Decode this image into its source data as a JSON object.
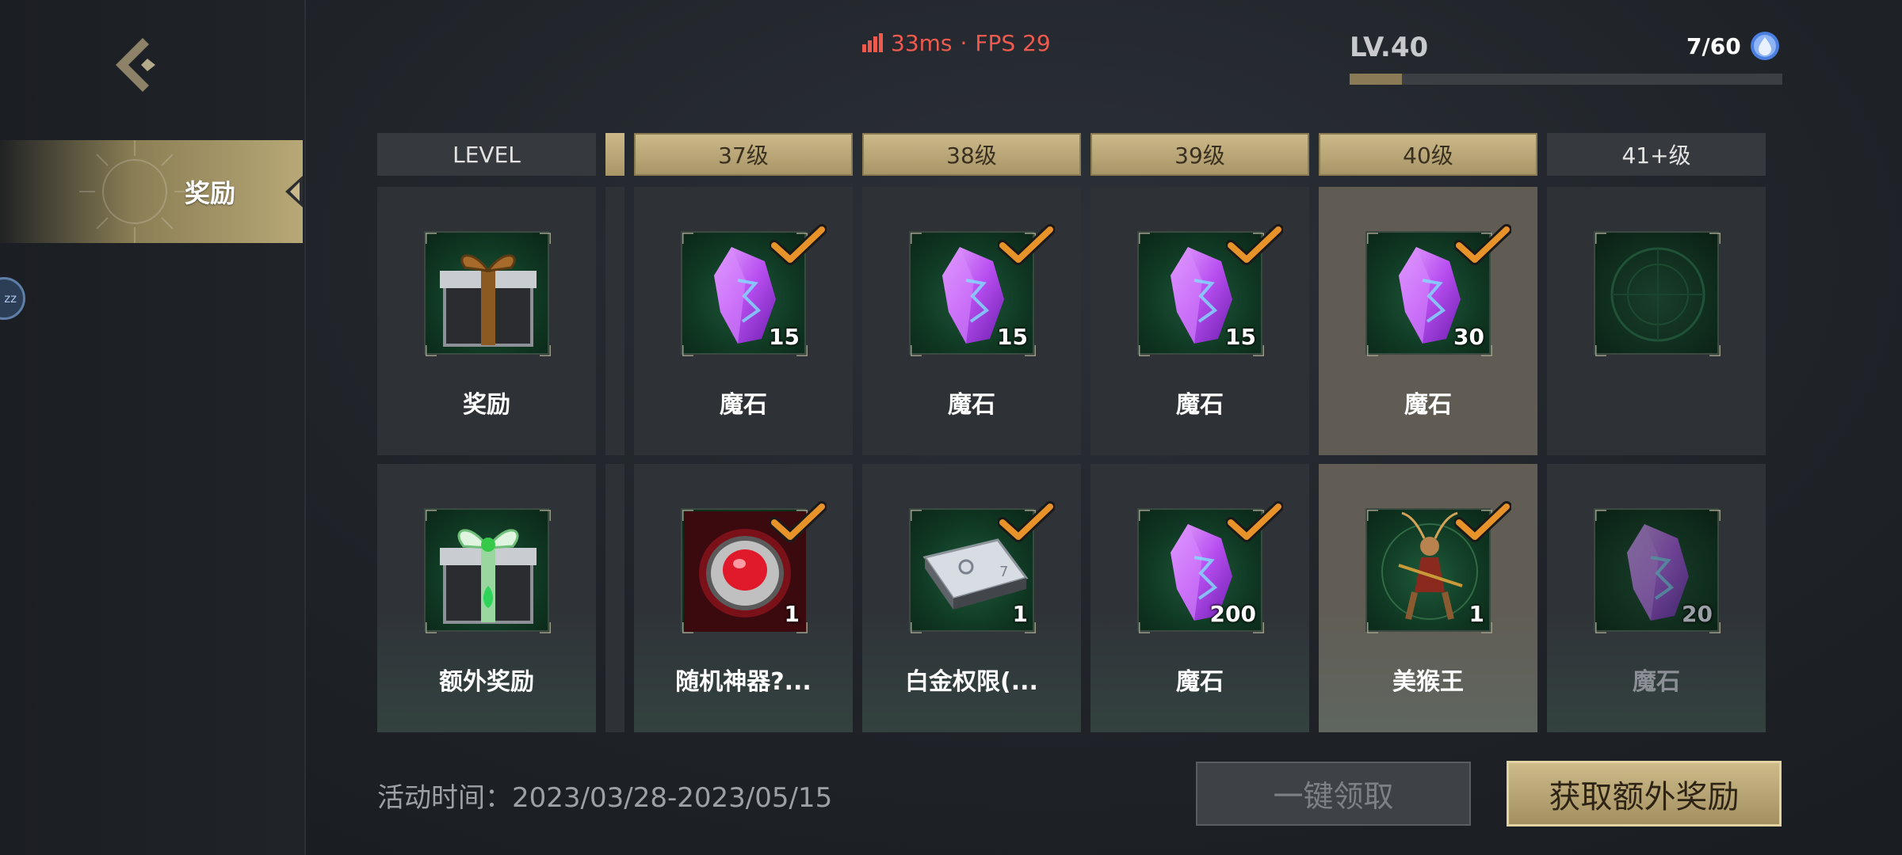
{
  "sidebar": {
    "tab_label": "奖励",
    "avatar_text": "zz"
  },
  "topbar": {
    "ping": "33ms",
    "fps": "FPS 29",
    "net_separator": "·",
    "level": "LV.40",
    "gems": "7/60",
    "xp_progress": 0.12
  },
  "table": {
    "row_header": "LEVEL",
    "columns": [
      {
        "label": "37级",
        "highlight": false
      },
      {
        "label": "38级",
        "highlight": false
      },
      {
        "label": "39级",
        "highlight": false
      },
      {
        "label": "40级",
        "highlight": true
      },
      {
        "label": "41+级",
        "highlight": false
      }
    ],
    "rows": [
      {
        "label": "奖励",
        "icon": "gift-box-black-icon",
        "items": [
          {
            "name": "魔石",
            "qty": "15",
            "icon": "purple-crystal-icon",
            "claimed": true
          },
          {
            "name": "魔石",
            "qty": "15",
            "icon": "purple-crystal-icon",
            "claimed": true
          },
          {
            "name": "魔石",
            "qty": "15",
            "icon": "purple-crystal-icon",
            "claimed": true
          },
          {
            "name": "魔石",
            "qty": "30",
            "icon": "purple-crystal-icon",
            "claimed": true
          },
          {
            "name": "",
            "qty": "",
            "icon": "empty-slot-icon",
            "claimed": false
          }
        ]
      },
      {
        "label": "额外奖励",
        "icon": "gift-box-green-icon",
        "items": [
          {
            "name": "随机神器?...",
            "qty": "1",
            "icon": "red-ring-icon",
            "claimed": true
          },
          {
            "name": "白金权限(...",
            "qty": "1",
            "icon": "platinum-card-icon",
            "claimed": true
          },
          {
            "name": "魔石",
            "qty": "200",
            "icon": "purple-crystal-icon",
            "claimed": true
          },
          {
            "name": "美猴王",
            "qty": "1",
            "icon": "monkey-king-icon",
            "claimed": true
          },
          {
            "name": "魔石",
            "qty": "20",
            "icon": "purple-crystal-icon",
            "claimed": false
          }
        ]
      }
    ]
  },
  "footer": {
    "event_time": "活动时间：2023/03/28-2023/05/15",
    "claim_all": "一键领取",
    "get_extra": "获取额外奖励"
  },
  "colors": {
    "gold": "#b8a877",
    "ping": "#ef5a4f",
    "check": "#e8922a",
    "crystal": "#b84ef0"
  }
}
